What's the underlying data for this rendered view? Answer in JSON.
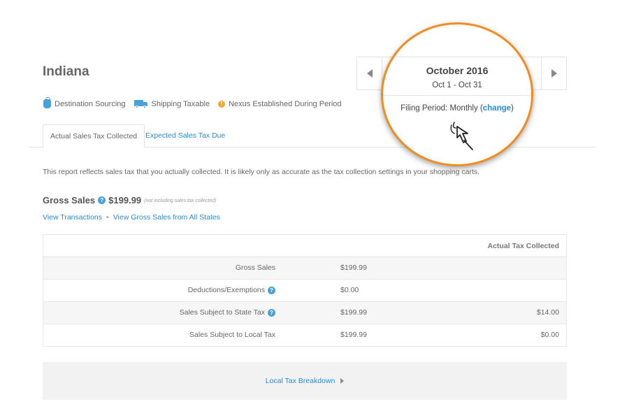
{
  "header": {
    "state_title": "Indiana"
  },
  "attributes": [
    {
      "icon": "money-bag-icon",
      "label": "Destination Sourcing"
    },
    {
      "icon": "truck-icon",
      "label": "Shipping Taxable"
    },
    {
      "icon": "exclamation-icon",
      "label": "Nexus Established During Period"
    }
  ],
  "tabs": [
    {
      "label": "Actual Sales Tax Collected",
      "active": true
    },
    {
      "label": "Expected Sales Tax Due",
      "active": false
    }
  ],
  "period": {
    "month": "October 2016",
    "range": "Oct 1 - Oct 31",
    "filing_prefix": "Filing Period: Monthly (",
    "filing_link": "change",
    "filing_suffix": ")"
  },
  "description": "This report reflects sales tax that you actually collected. It is likely only as accurate as the tax collection settings in your shopping carts.",
  "gross_sales": {
    "label": "Gross Sales",
    "amount": "$199.99",
    "note": "(not including sales tax collected)",
    "help_icon": "?"
  },
  "links": {
    "view_transactions": "View Transactions",
    "separator": "•",
    "view_all_states": "View Gross Sales from All States"
  },
  "table": {
    "header": "Actual Tax Collected",
    "rows": [
      {
        "label": "Gross Sales",
        "value": "$199.99",
        "tax": "",
        "help": false
      },
      {
        "label": "Deductions/Exemptions",
        "value": "$0.00",
        "tax": "",
        "help": true
      },
      {
        "label": "Sales Subject to State Tax",
        "value": "$199.99",
        "tax": "$14.00",
        "help": true
      },
      {
        "label": "Sales Subject to Local Tax",
        "value": "$199.99",
        "tax": "$0.00",
        "help": false
      }
    ]
  },
  "breakdown": {
    "label": "Local Tax Breakdown"
  },
  "colors": {
    "accent": "#2a8bd0",
    "callout": "#f28c1e",
    "warning": "#f0a830"
  }
}
